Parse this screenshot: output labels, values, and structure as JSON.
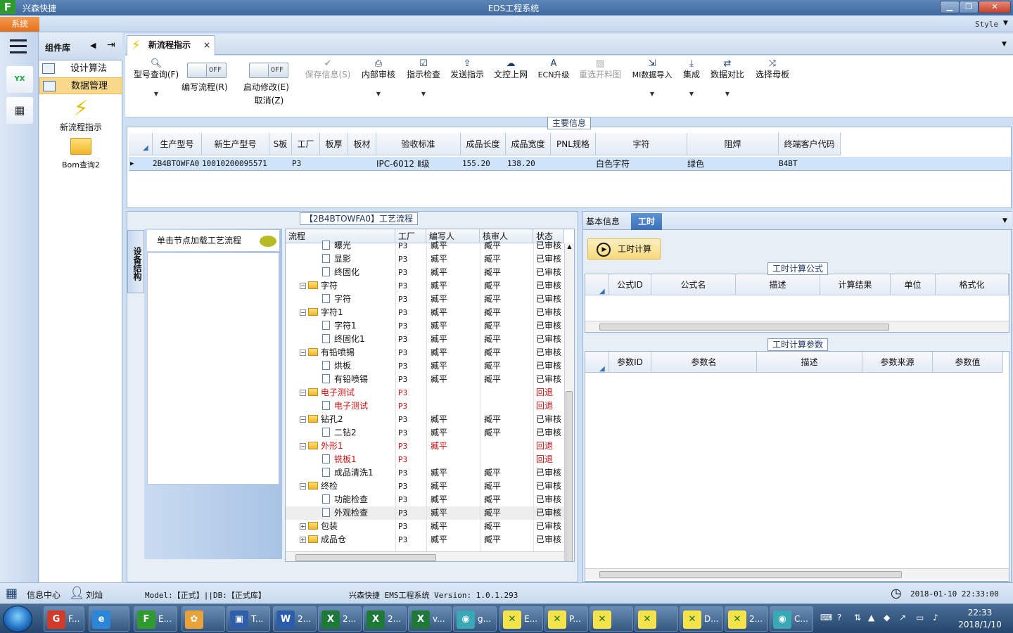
{
  "window": {
    "app_name": "兴森快捷",
    "title": "EDS工程系统",
    "minimize": "▁",
    "restore": "❐",
    "close": "✕",
    "style_label": "Style"
  },
  "menu": {
    "system": "系统"
  },
  "components": {
    "title": "组件库",
    "items": [
      {
        "label": "设计算法"
      },
      {
        "label": "数据管理"
      }
    ],
    "big_items": [
      {
        "label": "新流程指示"
      },
      {
        "label": "Bom查询2"
      }
    ]
  },
  "tab": {
    "label": "新流程指示",
    "close": "×"
  },
  "toolbar": {
    "query": "型号查询(F)",
    "toggle_text": "OFF",
    "write_flow": "编写流程(R)",
    "enable_edit": "启动修改(E)",
    "cancel": "取消(Z)",
    "save_info": "保存信息(S)",
    "internal_review": "内部审核",
    "instruction_check": "指示检查",
    "send_instruction": "发送指示",
    "upload": "文控上网",
    "ecn_upgrade": "ECN升级",
    "reselect": "重选开料图",
    "mi_import": "MI数据导入",
    "integrate": "集成",
    "compare": "数据对比",
    "select_mother": "选择母板"
  },
  "main_info": {
    "title": "主要信息",
    "columns": [
      "生产型号",
      "新生产型号",
      "S板",
      "工厂",
      "板厚",
      "板材",
      "验收标准",
      "成品长度",
      "成品宽度",
      "PNL规格",
      "字符",
      "阻焊",
      "终端客户代码"
    ],
    "row": {
      "model": "2B4BTOWFA0",
      "new_model": "10010200095571",
      "factory": "P3",
      "standard": "IPC-6012 Ⅱ级",
      "length": "155.20",
      "width": "138.20",
      "char": "白色字符",
      "mask": "绿色",
      "customer": "B4BT"
    }
  },
  "process": {
    "title": "【2B4BTOWFA0】工艺流程",
    "side_tab": "设备结构",
    "node_hint": "单击节点加载工艺流程",
    "columns": [
      "流程",
      "工厂",
      "编写人",
      "核审人",
      "状态"
    ],
    "rows": [
      {
        "name": "曝光",
        "factory": "P3",
        "writer": "臧平",
        "reviewer": "臧平",
        "status": "已审核"
      },
      {
        "name": "显影",
        "factory": "P3",
        "writer": "臧平",
        "reviewer": "臧平",
        "status": "已审核"
      },
      {
        "name": "终固化",
        "factory": "P3",
        "writer": "臧平",
        "reviewer": "臧平",
        "status": "已审核"
      },
      {
        "name": "字符",
        "factory": "P3",
        "writer": "臧平",
        "reviewer": "臧平",
        "status": "已审核"
      },
      {
        "name": "字符",
        "factory": "P3",
        "writer": "臧平",
        "reviewer": "臧平",
        "status": "已审核"
      },
      {
        "name": "字符1",
        "factory": "P3",
        "writer": "臧平",
        "reviewer": "臧平",
        "status": "已审核"
      },
      {
        "name": "字符1",
        "factory": "P3",
        "writer": "臧平",
        "reviewer": "臧平",
        "status": "已审核"
      },
      {
        "name": "终固化1",
        "factory": "P3",
        "writer": "臧平",
        "reviewer": "臧平",
        "status": "已审核"
      },
      {
        "name": "有铅喷锡",
        "factory": "P3",
        "writer": "臧平",
        "reviewer": "臧平",
        "status": "已审核"
      },
      {
        "name": "烘板",
        "factory": "P3",
        "writer": "臧平",
        "reviewer": "臧平",
        "status": "已审核"
      },
      {
        "name": "有铅喷锡",
        "factory": "P3",
        "writer": "臧平",
        "reviewer": "臧平",
        "status": "已审核"
      },
      {
        "name": "电子测试",
        "factory": "P3",
        "writer": "",
        "reviewer": "",
        "status": "回退"
      },
      {
        "name": "电子测试",
        "factory": "P3",
        "writer": "",
        "reviewer": "",
        "status": "回退"
      },
      {
        "name": "钻孔2",
        "factory": "P3",
        "writer": "臧平",
        "reviewer": "臧平",
        "status": "已审核"
      },
      {
        "name": "二钻2",
        "factory": "P3",
        "writer": "臧平",
        "reviewer": "臧平",
        "status": "已审核"
      },
      {
        "name": "外形1",
        "factory": "P3",
        "writer": "臧平",
        "reviewer": "",
        "status": "回退"
      },
      {
        "name": "铣板1",
        "factory": "P3",
        "writer": "",
        "reviewer": "",
        "status": "回退"
      },
      {
        "name": "成品清洗1",
        "factory": "P3",
        "writer": "臧平",
        "reviewer": "臧平",
        "status": "已审核"
      },
      {
        "name": "终检",
        "factory": "P3",
        "writer": "臧平",
        "reviewer": "臧平",
        "status": "已审核"
      },
      {
        "name": "功能检查",
        "factory": "P3",
        "writer": "臧平",
        "reviewer": "臧平",
        "status": "已审核"
      },
      {
        "name": "外观检查",
        "factory": "P3",
        "writer": "臧平",
        "reviewer": "臧平",
        "status": "已审核"
      },
      {
        "name": "包装",
        "factory": "P3",
        "writer": "臧平",
        "reviewer": "臧平",
        "status": "已审核"
      },
      {
        "name": "成品仓",
        "factory": "P3",
        "writer": "臧平",
        "reviewer": "臧平",
        "status": "已审核"
      }
    ]
  },
  "right": {
    "tab_basic": "基本信息",
    "tab_hours": "工时",
    "calc_button": "工时计算",
    "formula_title": "工时计算公式",
    "formula_columns": [
      "公式ID",
      "公式名",
      "描述",
      "计算结果",
      "单位",
      "格式化"
    ],
    "param_title": "工时计算参数",
    "param_columns": [
      "参数ID",
      "参数名",
      "描述",
      "参数来源",
      "参数值"
    ]
  },
  "status": {
    "info_center": "信息中心",
    "user": "刘灿",
    "model_db": "Model:【正式】||DB:【正式库】",
    "version": "兴森快捷 EMS工程系统 Version: 1.0.1.293",
    "datetime": "2018-01-10 22:33:00"
  },
  "taskbar": {
    "items": [
      "F...",
      "",
      "E...",
      "",
      "T...",
      "2...",
      "2...",
      "2...",
      "v...",
      "g...",
      "E...",
      "P...",
      "",
      "",
      "D...",
      "2...",
      "C..."
    ],
    "time": "22:33",
    "date": "2018/1/10"
  },
  "colors": {
    "selected_row": "#cfe3fb",
    "returned_status": "#d01010",
    "accent_orange": "#e56f1a",
    "active_tab_blue": "#3a6fb9"
  }
}
